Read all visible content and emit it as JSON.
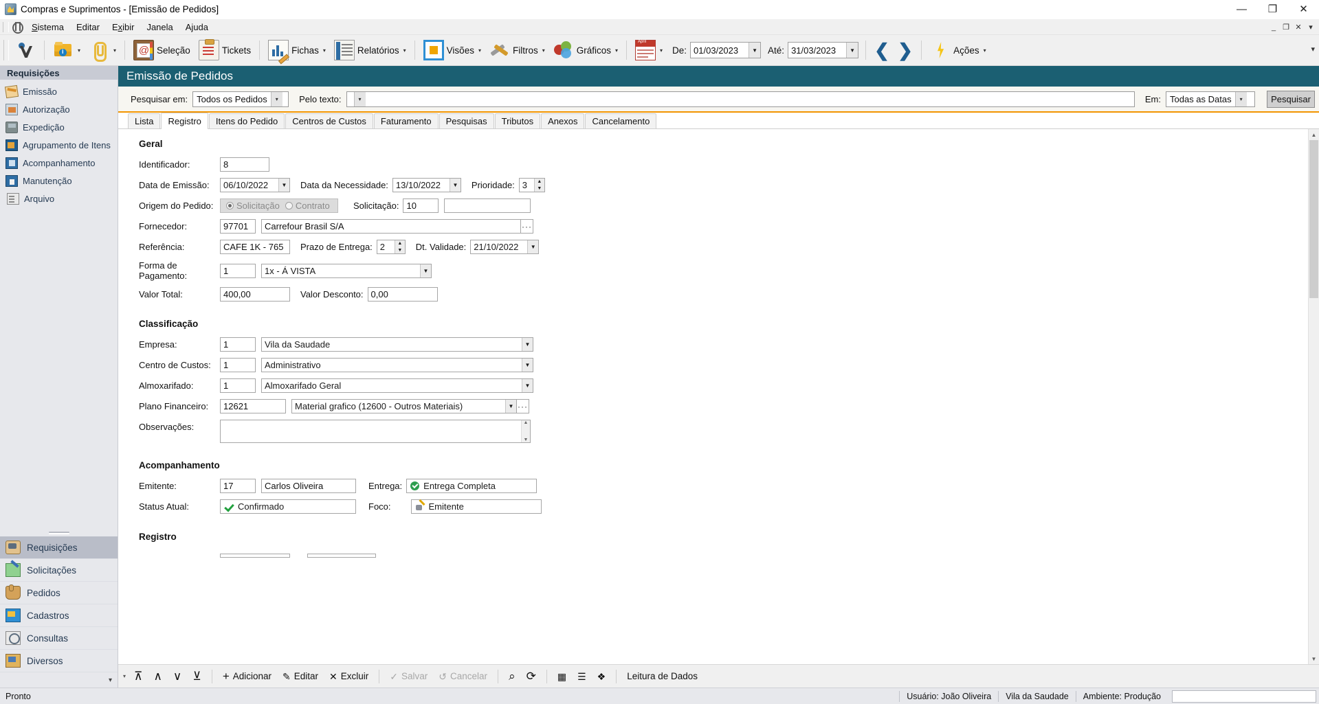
{
  "window": {
    "title": "Compras e Suprimentos - [Emissão de Pedidos]",
    "minimize": "—",
    "maximize": "❐",
    "close": "✕"
  },
  "menubar": {
    "items": [
      "Sistema",
      "Editar",
      "Exibir",
      "Janela",
      "Ajuda"
    ],
    "mdi_minimize": "_",
    "mdi_restore": "❐",
    "mdi_close": "✕",
    "overflow": "▾"
  },
  "toolbar": {
    "buttons": [
      {
        "name": "logo",
        "label": ""
      },
      {
        "name": "info-folder",
        "label": "",
        "caret": "▾"
      },
      {
        "name": "attachment",
        "label": "",
        "caret": "▾"
      },
      {
        "name": "selecao",
        "label": "Seleção"
      },
      {
        "name": "tickets",
        "label": "Tickets"
      },
      {
        "name": "fichas",
        "label": "Fichas",
        "caret": "▾"
      },
      {
        "name": "relatorios",
        "label": "Relatórios",
        "caret": "▾"
      },
      {
        "name": "visoes",
        "label": "Visões",
        "caret": "▾"
      },
      {
        "name": "filtros",
        "label": "Filtros",
        "caret": "▾"
      },
      {
        "name": "graficos",
        "label": "Gráficos",
        "caret": "▾"
      },
      {
        "name": "calendario",
        "label": "",
        "caret": "▾"
      }
    ],
    "date_from_label": "De:",
    "date_from_value": "01/03/2023",
    "date_to_label": "Até:",
    "date_to_value": "31/03/2023",
    "prev_arrow": "❮",
    "next_arrow": "❯",
    "acoes_label": "Ações",
    "acoes_caret": "▾",
    "overflow": "▾"
  },
  "sidebar": {
    "group_title": "Requisições",
    "items": [
      {
        "label": "Emissão",
        "icon": "emissao-icon"
      },
      {
        "label": "Autorização",
        "icon": "autorizacao-icon"
      },
      {
        "label": "Expedição",
        "icon": "expedicao-icon"
      },
      {
        "label": "Agrupamento de Itens",
        "icon": "agrupamento-icon"
      },
      {
        "label": "Acompanhamento",
        "icon": "acompanhamento-icon"
      },
      {
        "label": "Manutenção",
        "icon": "manutencao-icon"
      },
      {
        "label": "Arquivo",
        "icon": "arquivo-icon"
      }
    ],
    "modules": [
      {
        "label": "Requisições",
        "icon": "requisicoes-icon",
        "active": true
      },
      {
        "label": "Solicitações",
        "icon": "solicitacoes-icon",
        "active": false
      },
      {
        "label": "Pedidos",
        "icon": "pedidos-icon",
        "active": false
      },
      {
        "label": "Cadastros",
        "icon": "cadastros-icon",
        "active": false
      },
      {
        "label": "Consultas",
        "icon": "consultas-icon",
        "active": false
      },
      {
        "label": "Diversos",
        "icon": "diversos-icon",
        "active": false
      }
    ],
    "footer_caret": "▾"
  },
  "page": {
    "title": "Emissão de Pedidos"
  },
  "search": {
    "search_in_label": "Pesquisar em:",
    "search_in_value": "Todos os Pedidos",
    "by_text_label": "Pelo texto:",
    "by_text_value": "",
    "in_label": "Em:",
    "in_value": "Todas as Datas",
    "button_label": "Pesquisar",
    "arrow": "▾"
  },
  "tabs": [
    {
      "label": "Lista",
      "active": false
    },
    {
      "label": "Registro",
      "active": true
    },
    {
      "label": "Itens do Pedido",
      "active": false
    },
    {
      "label": "Centros de Custos",
      "active": false
    },
    {
      "label": "Faturamento",
      "active": false
    },
    {
      "label": "Pesquisas",
      "active": false
    },
    {
      "label": "Tributos",
      "active": false
    },
    {
      "label": "Anexos",
      "active": false
    },
    {
      "label": "Cancelamento",
      "active": false
    }
  ],
  "form": {
    "geral": {
      "title": "Geral",
      "identificador_label": "Identificador:",
      "identificador_value": "8",
      "data_emissao_label": "Data de Emissão:",
      "data_emissao_value": "06/10/2022",
      "data_necessidade_label": "Data da Necessidade:",
      "data_necessidade_value": "13/10/2022",
      "prioridade_label": "Prioridade:",
      "prioridade_value": "3",
      "origem_label": "Origem do Pedido:",
      "origem_option_1": "Solicitação",
      "origem_option_2": "Contrato",
      "solicitacao_label": "Solicitação:",
      "solicitacao_value": "10",
      "solicitacao_desc": "",
      "fornecedor_label": "Fornecedor:",
      "fornecedor_code": "97701",
      "fornecedor_name": "Carrefour Brasil S/A",
      "referencia_label": "Referência:",
      "referencia_value": "CAFE 1K - 765",
      "prazo_entrega_label": "Prazo de Entrega:",
      "prazo_entrega_value": "2",
      "dt_validade_label": "Dt. Validade:",
      "dt_validade_value": "21/10/2022",
      "forma_pagamento_label": "Forma de Pagamento:",
      "forma_pagamento_code": "1",
      "forma_pagamento_desc": "1x - Á VISTA",
      "valor_total_label": "Valor Total:",
      "valor_total_value": "400,00",
      "valor_desconto_label": "Valor Desconto:",
      "valor_desconto_value": "0,00"
    },
    "classificacao": {
      "title": "Classificação",
      "empresa_label": "Empresa:",
      "empresa_code": "1",
      "empresa_name": "Vila da Saudade",
      "centro_custos_label": "Centro de Custos:",
      "centro_custos_code": "1",
      "centro_custos_name": "Administrativo",
      "almoxarifado_label": "Almoxarifado:",
      "almoxarifado_code": "1",
      "almoxarifado_name": "Almoxarifado Geral",
      "plano_financeiro_label": "Plano Financeiro:",
      "plano_financeiro_code": "12621",
      "plano_financeiro_name": "Material grafico (12600 - Outros Materiais)",
      "observacoes_label": "Observações:",
      "observacoes_value": ""
    },
    "acompanhamento": {
      "title": "Acompanhamento",
      "emitente_label": "Emitente:",
      "emitente_code": "17",
      "emitente_name": "Carlos Oliveira",
      "entrega_label": "Entrega:",
      "entrega_value": "Entrega Completa",
      "status_atual_label": "Status Atual:",
      "status_atual_value": "Confirmado",
      "foco_label": "Foco:",
      "foco_value": "Emitente"
    },
    "registro": {
      "title": "Registro"
    }
  },
  "actionbar": {
    "nav_first": "⊼",
    "nav_prev": "∧",
    "nav_next": "∨",
    "nav_last": "⊻",
    "add_label": "Adicionar",
    "add_icon": "+",
    "edit_label": "Editar",
    "edit_icon": "✎",
    "delete_label": "Excluir",
    "delete_icon": "✕",
    "save_label": "Salvar",
    "save_icon": "✓",
    "cancel_label": "Cancelar",
    "cancel_icon": "↺",
    "search_icon": "⌕",
    "refresh_icon": "⟳",
    "grid_icon": "▦",
    "list_icon": "☰",
    "layers_icon": "❖",
    "mode_label": "Leitura de Dados",
    "overflow": "▾"
  },
  "statusbar": {
    "state": "Pronto",
    "user": "Usuário: João Oliveira",
    "company": "Vila da Saudade",
    "environment": "Ambiente: Produção",
    "extra": ""
  }
}
